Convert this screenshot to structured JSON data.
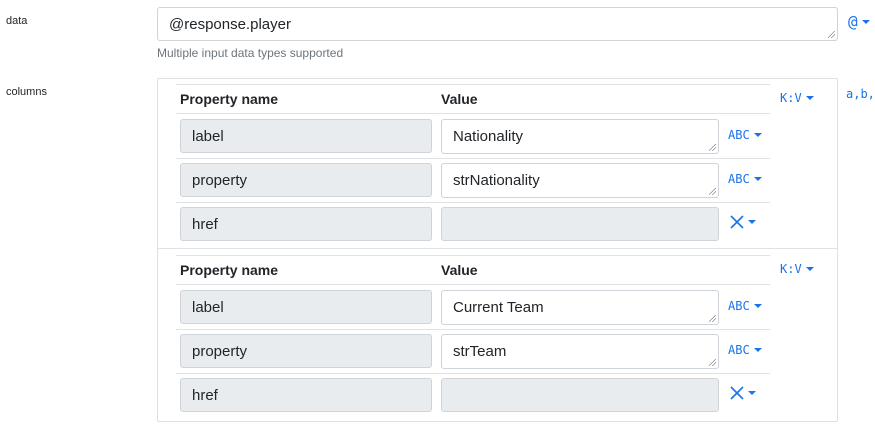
{
  "data_field": {
    "label": "data",
    "value": "@response.player",
    "help": "Multiple input data types supported",
    "type_icon": "at-icon",
    "type_label": "@"
  },
  "columns_field": {
    "label": "columns",
    "type_label": "a,b,c",
    "groups": [
      {
        "type_label": "K:V",
        "header_property": "Property name",
        "header_value": "Value",
        "rows": [
          {
            "property": "label",
            "value": "Nationality",
            "type": "ABC"
          },
          {
            "property": "property",
            "value": "strNationality",
            "type": "ABC"
          },
          {
            "property": "href",
            "value": "",
            "type": "null"
          }
        ]
      },
      {
        "type_label": "K:V",
        "header_property": "Property name",
        "header_value": "Value",
        "rows": [
          {
            "property": "label",
            "value": "Current Team",
            "type": "ABC"
          },
          {
            "property": "property",
            "value": "strTeam",
            "type": "ABC"
          },
          {
            "property": "href",
            "value": "",
            "type": "null"
          }
        ]
      }
    ]
  },
  "colors": {
    "accent": "#1a73e8",
    "border": "#dee2e6",
    "readonly_bg": "#e9ecef"
  }
}
